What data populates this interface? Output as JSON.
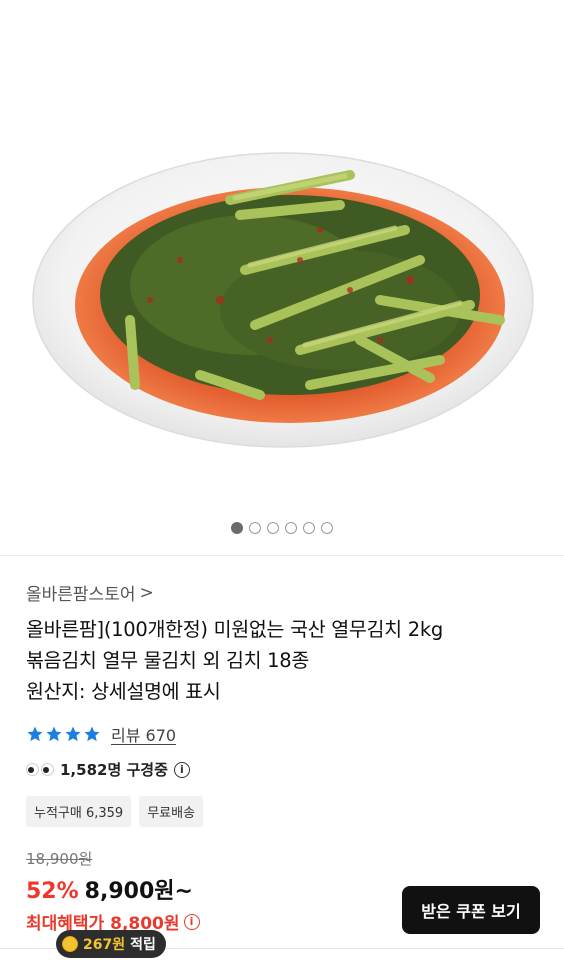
{
  "product_image": {
    "alt_icon": "kimchi-dish-image",
    "carousel": {
      "count": 6,
      "active_index": 0
    }
  },
  "store": {
    "name": "올바른팜스토어",
    "chevron": ">"
  },
  "product": {
    "title_line1": "올바른팜](100개한정) 미원없는 국산 열무김치 2kg",
    "title_line2": "볶음김치 열무 물김치 외 김치 18종",
    "title_line3": "원산지: 상세설명에 표시"
  },
  "rating": {
    "stars": 4,
    "star_color": "#1a7fe0",
    "review_label": "리뷰 670"
  },
  "viewers": {
    "text": "1,582명 구경중",
    "info_glyph": "i"
  },
  "tags": [
    {
      "label": "누적구매 6,359"
    },
    {
      "label": "무료배송"
    }
  ],
  "pricing": {
    "original": "18,900원",
    "discount": "52%",
    "price": "8,900원~",
    "max_benefit": "최대혜택가 8,800원",
    "accent_color": "#f1362b"
  },
  "coupon_button": {
    "label": "받은 쿠폰 보기"
  },
  "points": {
    "amount": "267원",
    "suffix": "적립"
  }
}
